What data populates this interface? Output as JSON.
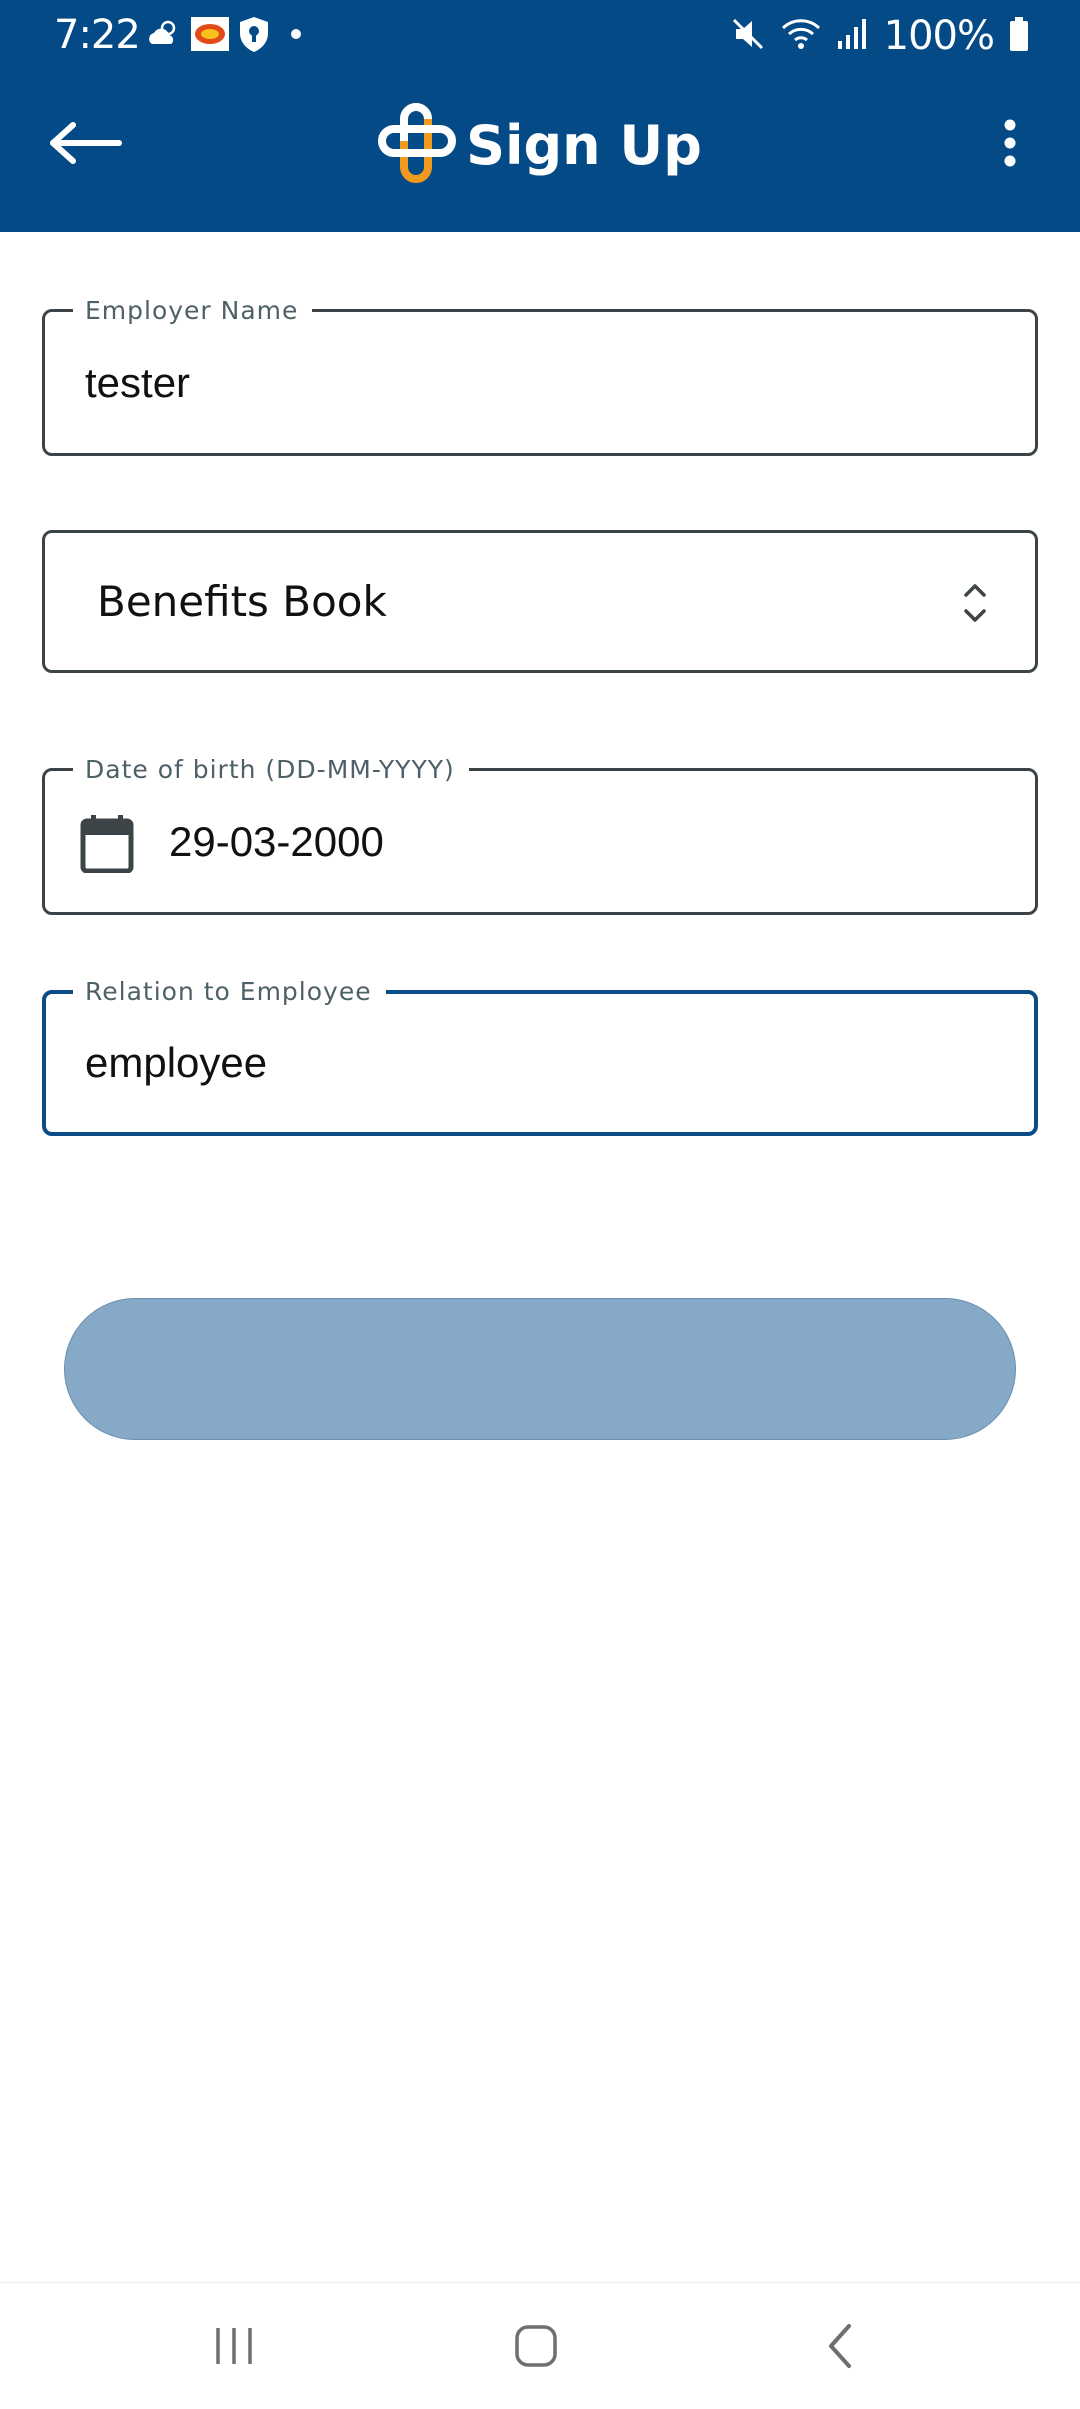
{
  "status_bar": {
    "time": "7:22",
    "battery": "100%"
  },
  "app_bar": {
    "title": "Sign Up"
  },
  "form": {
    "employer_name": {
      "label": "Employer Name",
      "value": "tester"
    },
    "benefits": {
      "selected": "Benefits Book"
    },
    "dob": {
      "label": "Date of birth (DD-MM-YYYY)",
      "value": "29-03-2000"
    },
    "relation": {
      "label": "Relation to Employee",
      "value": "employee"
    }
  },
  "colors": {
    "primary": "#044a86",
    "button_disabled": "#86a9c8",
    "logo_orange": "#f29a1f",
    "focused_border": "#0b4c86"
  },
  "icons": {
    "status_left": [
      "weather-icon",
      "app-badge-icon",
      "shield-icon",
      "dot-icon"
    ],
    "status_right": [
      "mute-icon",
      "wifi-icon",
      "signal-icon",
      "battery-icon"
    ],
    "app_bar": [
      "back-arrow-icon",
      "logo-icon",
      "more-vert-icon"
    ],
    "nav": [
      "recents-icon",
      "home-icon",
      "back-icon"
    ]
  }
}
